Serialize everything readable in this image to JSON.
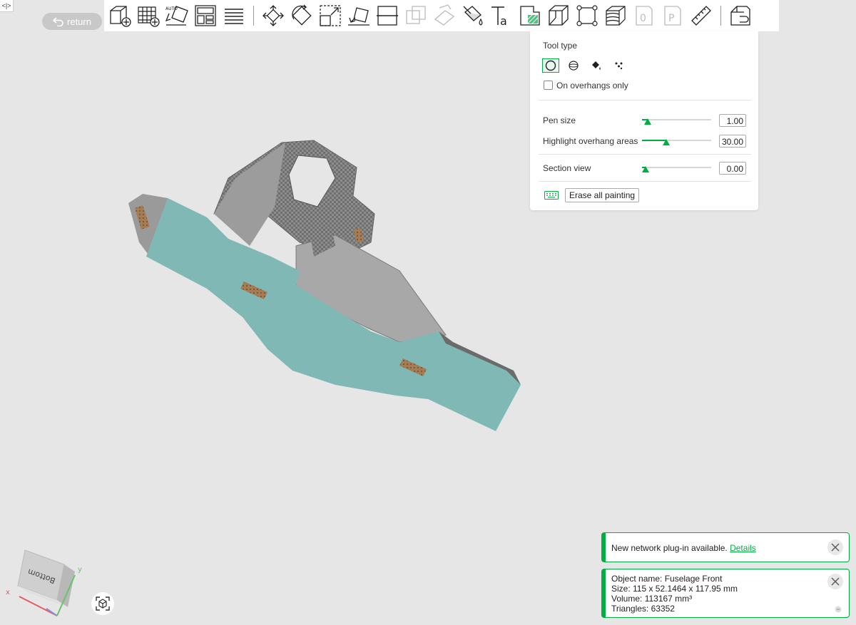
{
  "collapse_toggle": "<|>",
  "return_button": {
    "label": "return"
  },
  "toolbar": {
    "buttons": [
      {
        "icon": "add-object-icon"
      },
      {
        "icon": "add-plate-icon"
      },
      {
        "icon": "auto-orient-icon"
      },
      {
        "icon": "arrange-icon"
      },
      {
        "icon": "layers-icon"
      },
      {
        "icon": "move-icon"
      },
      {
        "icon": "rotate-icon"
      },
      {
        "icon": "scale-icon"
      },
      {
        "icon": "lay-on-face-icon"
      },
      {
        "icon": "cut-icon"
      },
      {
        "icon": "boolean-icon"
      },
      {
        "icon": "support-painting-icon"
      },
      {
        "icon": "color-painting-icon"
      },
      {
        "icon": "text-emboss-icon"
      },
      {
        "icon": "seam-painting-icon"
      },
      {
        "icon": "mesh-icon"
      },
      {
        "icon": "assembly-icon"
      },
      {
        "icon": "variable-layer-icon"
      },
      {
        "icon": "brim-ears-icon"
      },
      {
        "icon": "part-icon"
      },
      {
        "icon": "measure-icon"
      },
      {
        "icon": "assembly-view-icon"
      }
    ]
  },
  "paint_panel": {
    "tool_type_label": "Tool type",
    "tools": [
      {
        "name": "circle-brush",
        "active": true
      },
      {
        "name": "sphere-brush",
        "active": false
      },
      {
        "name": "fill-bucket",
        "active": false
      },
      {
        "name": "gap-fill",
        "active": false
      }
    ],
    "overhangs_only_label": "On overhangs only",
    "overhangs_only_checked": false,
    "pen_size": {
      "label": "Pen size",
      "value": "1.00",
      "fraction": 0.08
    },
    "highlight_overhang": {
      "label": "Highlight overhang areas",
      "value": "30.00",
      "fraction": 0.35
    },
    "section_view": {
      "label": "Section view",
      "value": "0.00",
      "fraction": 0.05
    },
    "erase_label": "Erase all painting"
  },
  "notifications": {
    "plugin": {
      "text": "New network plug-in available.",
      "link": "Details"
    },
    "object_info": {
      "name": "Object name: Fuselage Front",
      "size": "Size: 115 x 52.1464 x 117.95 mm",
      "volume": "Volume: 113167 mm³",
      "triangles": "Triangles: 63352"
    }
  },
  "nav_cube": {
    "face_label": "Bottom",
    "axis_x": "x",
    "axis_y": "y"
  },
  "colors": {
    "accent": "#00ae42",
    "model_face": "#7fb8b5",
    "model_gray": "#9a9a9a",
    "viewport_bg": "#e6e6e6"
  }
}
